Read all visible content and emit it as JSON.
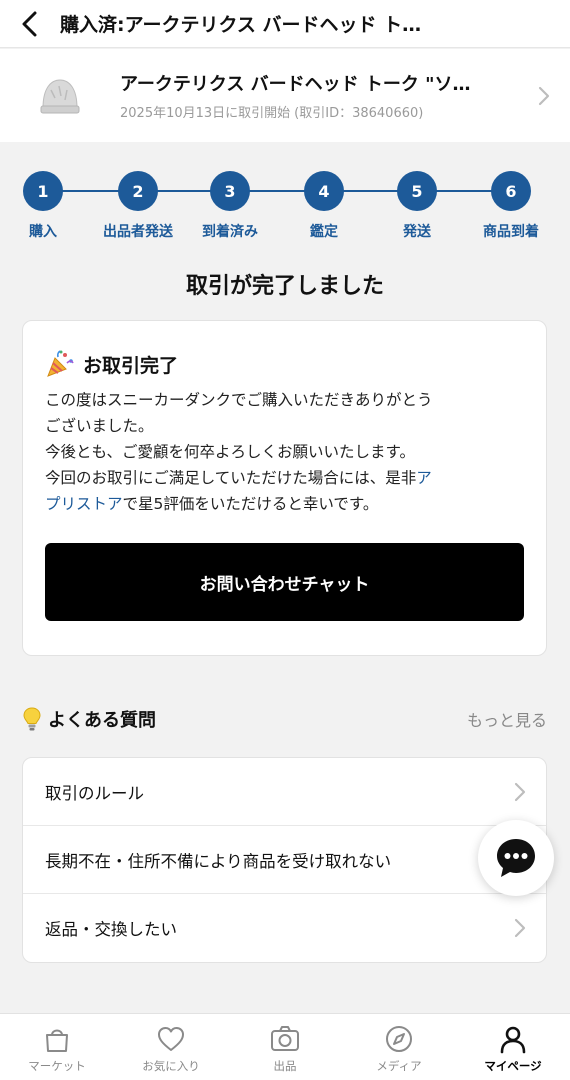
{
  "header": {
    "title": "購入済:アークテリクス バードヘッド ト…"
  },
  "product": {
    "name": "アークテリクス バードヘッド トーク \"ソ…",
    "started": "2025年10月13日に取引開始",
    "transaction_id": "(取引ID：38640660)"
  },
  "steps": [
    {
      "number": "1",
      "label": "購入"
    },
    {
      "number": "2",
      "label": "出品者発送"
    },
    {
      "number": "3",
      "label": "到着済み"
    },
    {
      "number": "4",
      "label": "鑑定"
    },
    {
      "number": "5",
      "label": "発送"
    },
    {
      "number": "6",
      "label": "商品到着"
    }
  ],
  "status_title": "取引が完了しました",
  "completion_card": {
    "heading": "お取引完了",
    "line1": "この度はスニーカーダンクでご購入いただきありがとう",
    "line2": "ございました。",
    "line3": "今後とも、ご愛顧を何卒よろしくお願いいたします。",
    "line4_prefix": "今回のお取引にご満足していただけた場合には、是非",
    "line4_link_a": "ア",
    "line5_link_b": "プリストア",
    "line5_suffix": "で星5評価をいただけると幸いです。",
    "chat_button": "お問い合わせチャット"
  },
  "faq": {
    "title": "よくある質問",
    "more": "もっと見る",
    "items": [
      {
        "label": "取引のルール"
      },
      {
        "label": "長期不在・住所不備により商品を受け取れない"
      },
      {
        "label": "返品・交換したい"
      }
    ]
  },
  "tabs": [
    {
      "label": "マーケット",
      "icon": "bag-icon"
    },
    {
      "label": "お気に入り",
      "icon": "heart-icon"
    },
    {
      "label": "出品",
      "icon": "camera-icon"
    },
    {
      "label": "メディア",
      "icon": "compass-icon"
    },
    {
      "label": "マイページ",
      "icon": "person-icon",
      "active": true
    }
  ],
  "colors": {
    "accent": "#1d5a99",
    "button": "#000000"
  }
}
